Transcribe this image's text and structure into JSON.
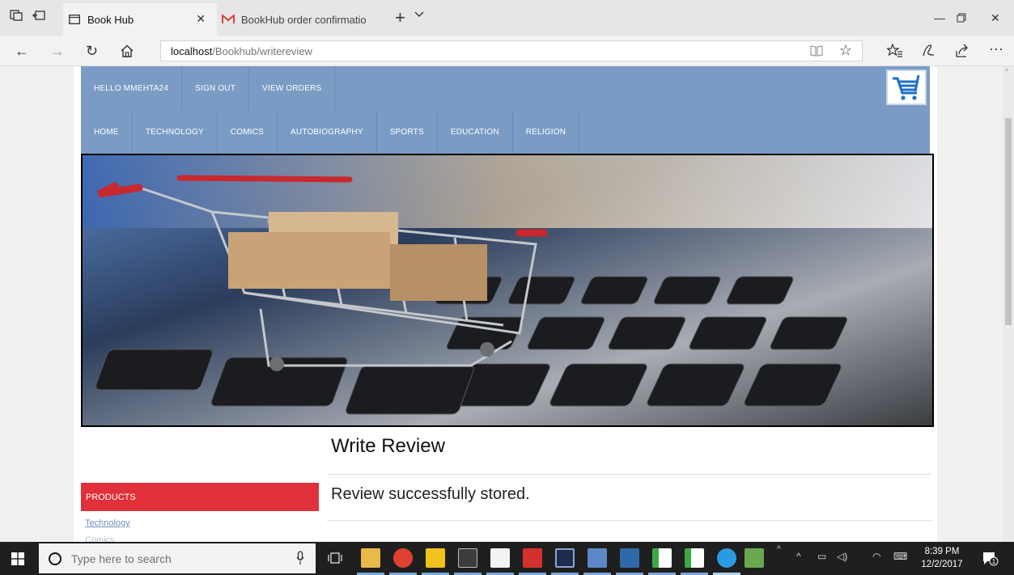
{
  "browser": {
    "tabs": [
      {
        "label": "Book Hub",
        "active": true
      },
      {
        "label": "BookHub order confirmatio",
        "active": false
      }
    ],
    "url_host": "localhost",
    "url_path": "/Bookhub/writereview"
  },
  "site": {
    "user_nav": [
      "HELLO MMEHTA24",
      "SIGN OUT",
      "VIEW ORDERS"
    ],
    "category_nav": [
      "HOME",
      "TECHNOLOGY",
      "COMICS",
      "AUTOBIOGRAPHY",
      "SPORTS",
      "EDUCATION",
      "RELIGION"
    ],
    "sidebar": {
      "heading": "PRODUCTS",
      "links": [
        "Technology",
        "Comics"
      ]
    },
    "main": {
      "title": "Write Review",
      "message": "Review successfully stored."
    }
  },
  "taskbar": {
    "search_placeholder": "Type here to search",
    "time": "8:39 PM",
    "date": "12/2/2017",
    "notification_count": "1"
  },
  "colors": {
    "nav_blue": "#7a9cc4",
    "products_red": "#e03039",
    "link_blue": "#6d8fb8"
  }
}
